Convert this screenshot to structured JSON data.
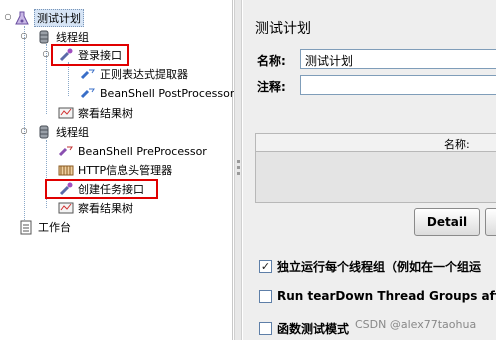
{
  "tree": {
    "test_plan": "测试计划",
    "thread_group_1": "线程组",
    "login_api": "登录接口",
    "regex_extractor": "正则表达式提取器",
    "beanshell_post": "BeanShell PostProcessor",
    "view_results_1": "察看结果树",
    "thread_group_2": "线程组",
    "beanshell_pre": "BeanShell PreProcessor",
    "http_header_manager": "HTTP信息头管理器",
    "create_task_api": "创建任务接口",
    "view_results_2": "察看结果树",
    "workbench": "工作台"
  },
  "panel": {
    "title": "测试计划",
    "name_label": "名称:",
    "name_value": "测试计划",
    "comment_label": "注释:",
    "var_table_header": "名称:",
    "detail_button": "Detail",
    "checkbox_1_label": "独立运行每个线程组（例如在一个组运",
    "checkbox_1_checked": true,
    "checkbox_2_label": "Run tearDown Thread Groups after shu",
    "checkbox_2_checked": false,
    "checkbox_3_label": "函数测试模式",
    "checkbox_3_checked": false
  },
  "watermark": "CSDN @alex77taohua",
  "colors": {
    "highlight_box": "#e00000",
    "selection_bg": "#d6e4f5"
  }
}
